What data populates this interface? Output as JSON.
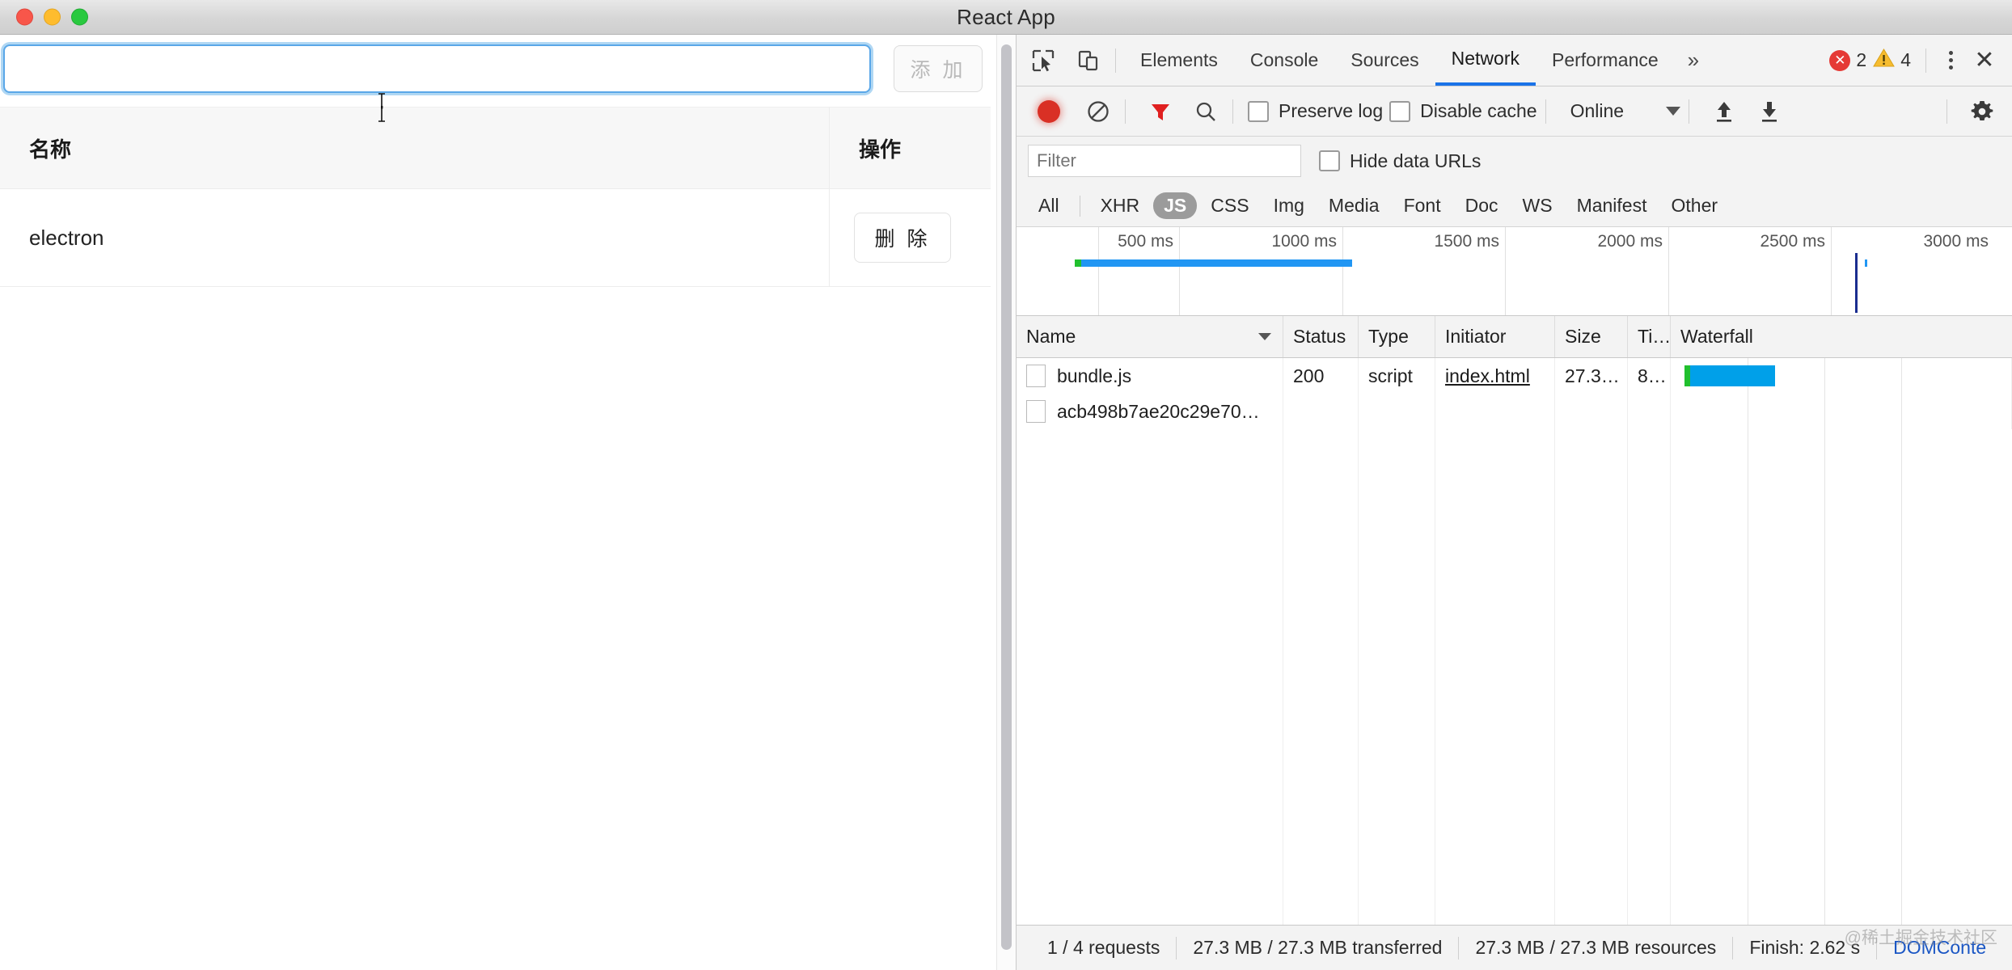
{
  "window": {
    "title": "React App",
    "traffic_lights": [
      "close-red",
      "minimize-yellow",
      "maximize-green"
    ]
  },
  "app": {
    "input": {
      "value": "",
      "placeholder": ""
    },
    "add_button": "添 加",
    "table": {
      "headers": [
        "名称",
        "操作"
      ],
      "rows": [
        {
          "name": "electron",
          "action": "删 除"
        }
      ]
    }
  },
  "devtools": {
    "tabs": [
      {
        "label": "Elements",
        "active": false
      },
      {
        "label": "Console",
        "active": false
      },
      {
        "label": "Sources",
        "active": false
      },
      {
        "label": "Network",
        "active": true
      },
      {
        "label": "Performance",
        "active": false
      }
    ],
    "more_tabs_icon": "»",
    "error_count": "2",
    "warning_count": "4",
    "toolbar": {
      "record_icon": "record-dot-icon",
      "clear_icon": "clear-icon",
      "filter_icon": "funnel-icon",
      "search_icon": "search-icon",
      "preserve_log": {
        "label": "Preserve log",
        "checked": false
      },
      "disable_cache": {
        "label": "Disable cache",
        "checked": false
      },
      "throttling": "Online",
      "import_icon": "upload-icon",
      "export_icon": "download-icon",
      "settings_icon": "gear-icon"
    },
    "filter": {
      "placeholder": "Filter",
      "value": "",
      "hide_data_urls": {
        "label": "Hide data URLs",
        "checked": false
      },
      "types": [
        {
          "label": "All",
          "selected": false
        },
        {
          "label": "XHR",
          "selected": false
        },
        {
          "label": "JS",
          "selected": true
        },
        {
          "label": "CSS",
          "selected": false
        },
        {
          "label": "Img",
          "selected": false
        },
        {
          "label": "Media",
          "selected": false
        },
        {
          "label": "Font",
          "selected": false
        },
        {
          "label": "Doc",
          "selected": false
        },
        {
          "label": "WS",
          "selected": false
        },
        {
          "label": "Manifest",
          "selected": false
        },
        {
          "label": "Other",
          "selected": false
        }
      ]
    },
    "overview": {
      "ticks": [
        "500 ms",
        "1000 ms",
        "1500 ms",
        "2000 ms",
        "2500 ms",
        "3000 ms"
      ],
      "max_ms": 3280
    },
    "table": {
      "columns": [
        "Name",
        "Status",
        "Type",
        "Initiator",
        "Size",
        "Ti…",
        "Waterfall"
      ],
      "sorted_column": "Name",
      "rows": [
        {
          "name": "bundle.js",
          "status": "200",
          "type": "script",
          "initiator": "index.html",
          "size": "27.3…",
          "time": "8…"
        },
        {
          "name": "acb498b7ae20c29e70…",
          "status": "",
          "type": "",
          "initiator": "",
          "size": "",
          "time": ""
        }
      ]
    },
    "status_bar": {
      "requests": "1 / 4 requests",
      "transferred": "27.3 MB / 27.3 MB transferred",
      "resources": "27.3 MB / 27.3 MB resources",
      "finish": "Finish: 2.62 s",
      "domcontent": "DOMConte"
    }
  },
  "watermark": "@稀土掘金技术社区",
  "colors": {
    "accent_blue": "#1a73e8",
    "record_red": "#d93025",
    "waterfall_blue": "#00a0e9",
    "waterfall_green": "#21c02e",
    "focus_blue": "#5aa7e8"
  }
}
